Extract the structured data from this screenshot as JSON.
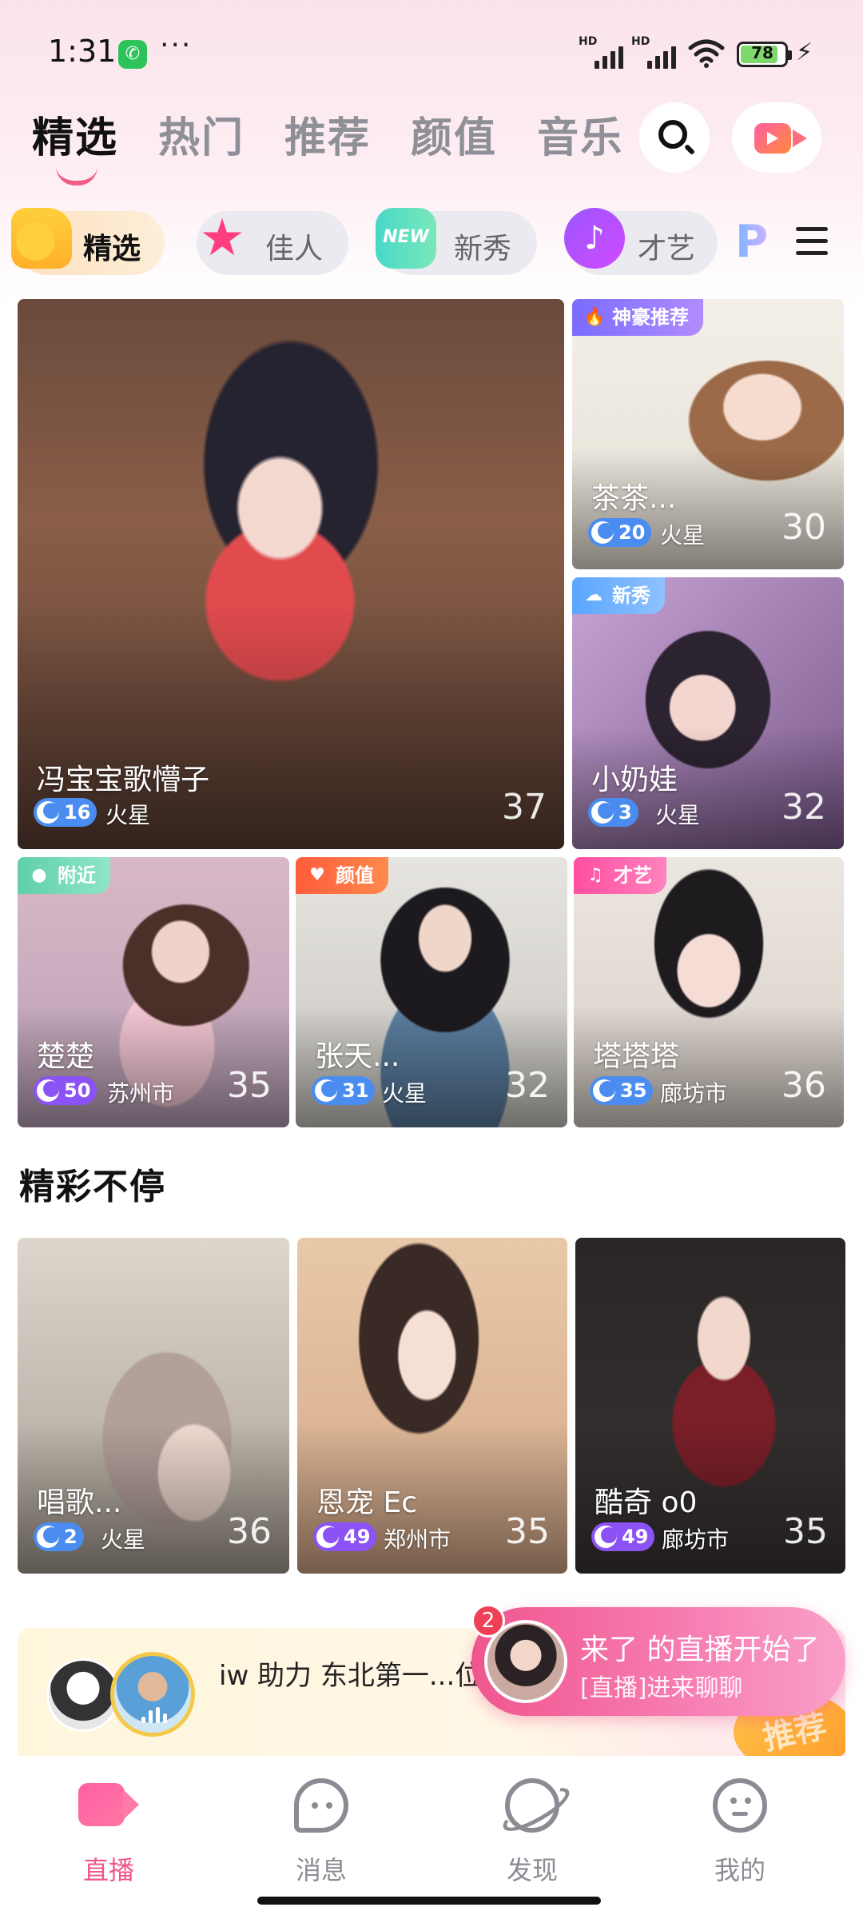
{
  "status": {
    "time": "1:31",
    "battery": "78",
    "wechat_icon": "wechat-notification-icon",
    "more": "···"
  },
  "tabs": [
    {
      "label": "精选",
      "active": true
    },
    {
      "label": "热门",
      "active": false
    },
    {
      "label": "推荐",
      "active": false
    },
    {
      "label": "颜值",
      "active": false
    },
    {
      "label": "音乐",
      "active": false
    }
  ],
  "categories": [
    {
      "label": "精选",
      "icon": "thumbs-up-icon",
      "active": true
    },
    {
      "label": "佳人",
      "icon": "star-icon",
      "active": false
    },
    {
      "label": "新秀",
      "icon": "new-badge-icon",
      "active": false
    },
    {
      "label": "才艺",
      "icon": "music-note-icon",
      "active": false
    }
  ],
  "featured": {
    "main": {
      "name": "冯宝宝歌懵子",
      "level": "16",
      "location": "火星",
      "count": "37"
    },
    "side": [
      {
        "badge": "神豪推荐",
        "name": "茶茶...",
        "level": "20",
        "location": "火星",
        "count": "30"
      },
      {
        "badge": "新秀",
        "name": "小奶娃",
        "level": "3",
        "location": "火星",
        "count": "32"
      }
    ],
    "row": [
      {
        "badge": "附近",
        "name": "楚楚",
        "level": "50",
        "location": "苏州市",
        "count": "35"
      },
      {
        "badge": "颜值",
        "name": "张天...",
        "level": "31",
        "location": "火星",
        "count": "32"
      },
      {
        "badge": "才艺",
        "name": "塔塔塔",
        "level": "35",
        "location": "廊坊市",
        "count": "36"
      }
    ]
  },
  "section": {
    "title": "精彩不停",
    "cards": [
      {
        "name": "唱歌...",
        "level": "2",
        "location": "火星",
        "count": "36"
      },
      {
        "name": "恩宠 Ec",
        "level": "49",
        "location": "郑州市",
        "count": "35"
      },
      {
        "name": "酷奇 o0",
        "level": "49",
        "location": "廊坊市",
        "count": "35"
      }
    ]
  },
  "banner": {
    "text": "iw 助力 东北第一...位",
    "tag": "推荐"
  },
  "toast": {
    "count": "2",
    "title": "来了 的直播开始了",
    "subtitle": "[直播]进来聊聊"
  },
  "bottom_nav": [
    {
      "label": "直播",
      "active": true
    },
    {
      "label": "消息",
      "active": false
    },
    {
      "label": "发现",
      "active": false
    },
    {
      "label": "我的",
      "active": false
    }
  ],
  "colors": {
    "accent": "#f0568e",
    "level_blue": "#4a8cf0",
    "level_purple": "#8b52f5"
  }
}
